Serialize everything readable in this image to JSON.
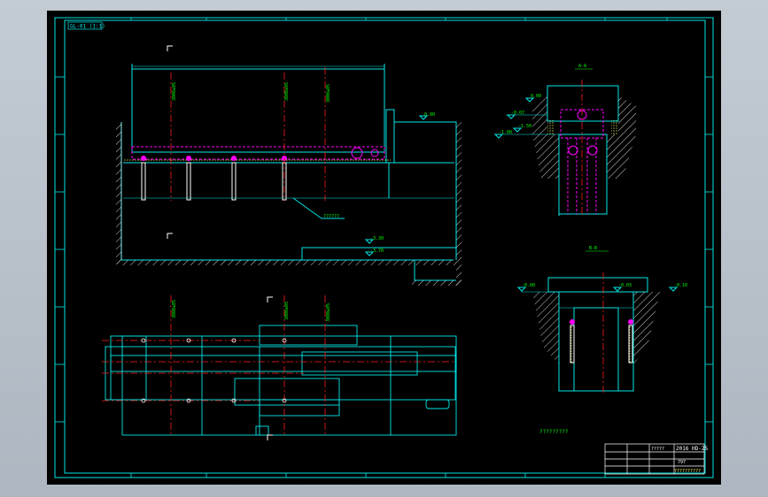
{
  "drawing": {
    "corner_label": "GL-01 (1:1)",
    "sheet_note": "?????????",
    "leader_text": "??????",
    "section_label_top": "A-A",
    "section_label_bottom": "B-B",
    "level_top_right": "0.00",
    "level_mid_1": "-3.30",
    "level_mid_2": "-3.70",
    "level_sec_a": "-0.07",
    "level_sec_b": "-1.00",
    "level_sec_c": "-1.50",
    "level_sec_d": "0.00",
    "level_sec_e": "-0.60",
    "level_sec_f": "-0.10",
    "level_sec_g": "-0.03"
  },
  "title_block": {
    "code": "2016 HD-25",
    "subtitle": "?????",
    "sheet_no": "797",
    "company": "??????????"
  },
  "colors": {
    "line": "#00e6e6",
    "center": "#ff2020",
    "pipe": "#ff00ff",
    "hatch": "#ffffff",
    "label": "#00ff00",
    "text": "#ffffff",
    "grout": "#ffff66"
  }
}
